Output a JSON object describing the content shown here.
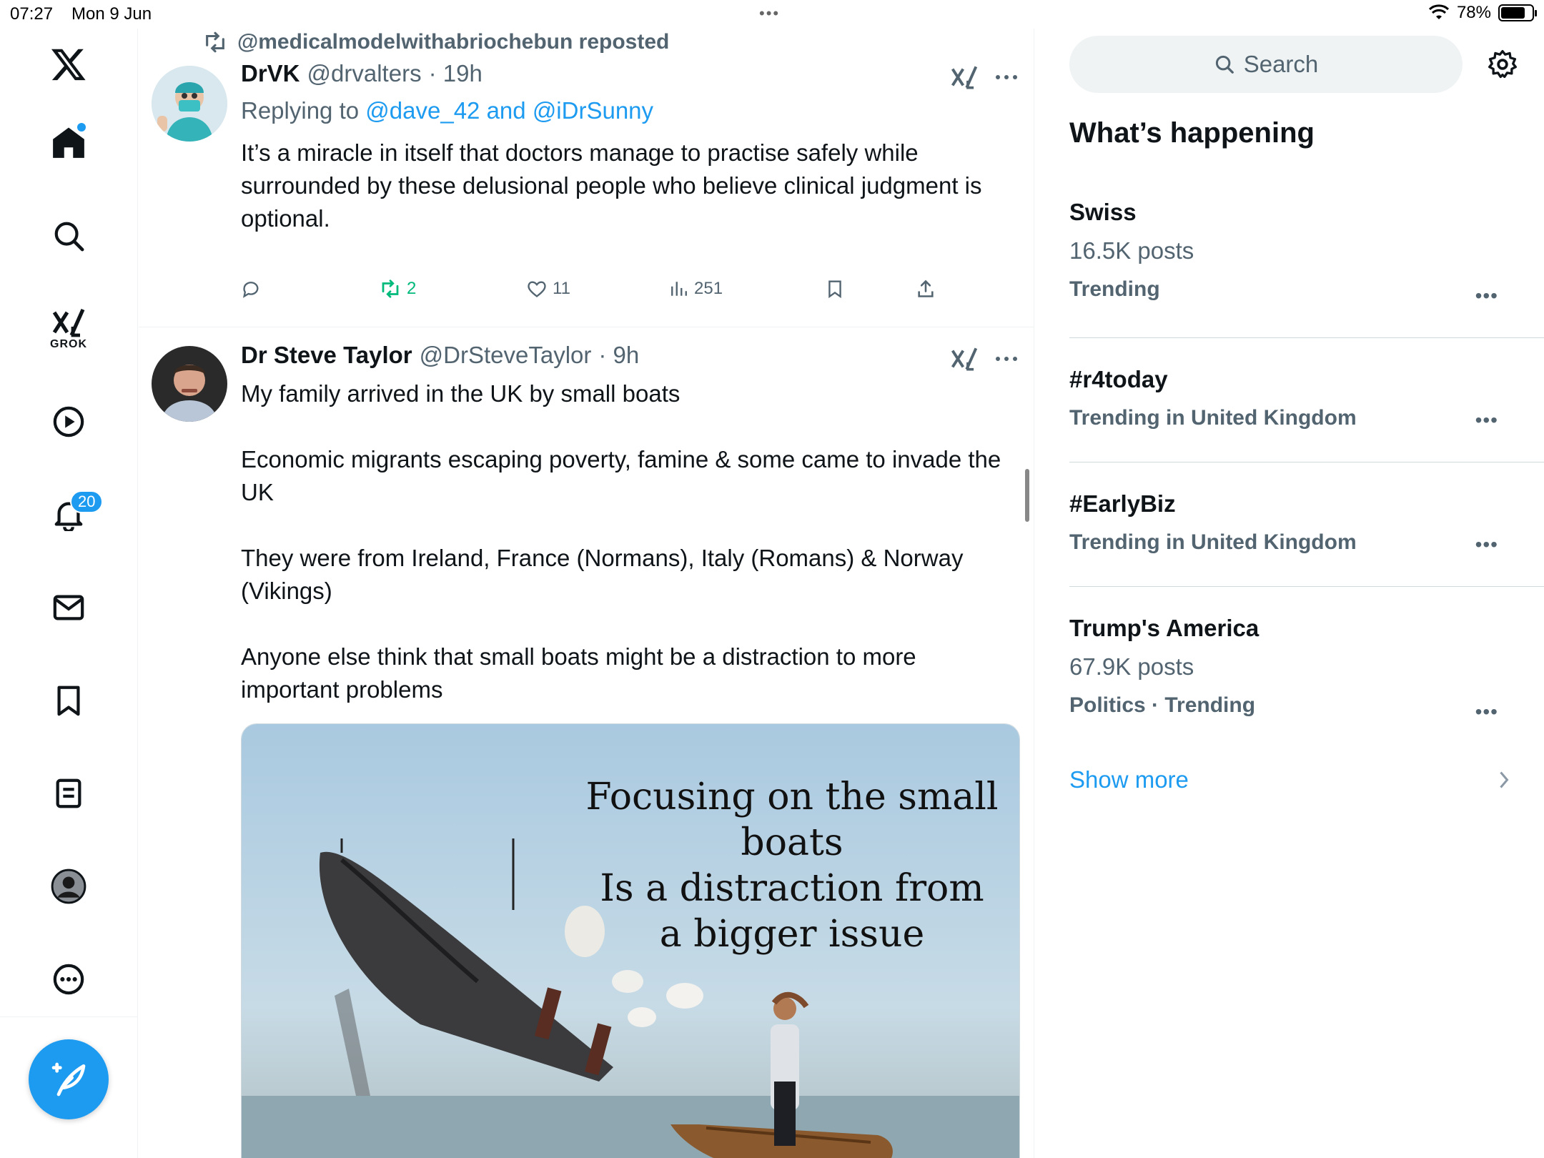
{
  "status_bar": {
    "time": "07:27",
    "date": "Mon 9 Jun",
    "battery": "78%",
    "battery_level": 0.78
  },
  "nav": {
    "notifications_badge": "20",
    "grok_label": "GROK"
  },
  "feed": {
    "repost_label": "@medicalmodelwithabriochebun reposted",
    "tweet1": {
      "name": "DrVK",
      "handle": "@drvalters",
      "time": "· 19h",
      "replying_prefix": "Replying to",
      "replying_to_1": "@dave_42",
      "replying_and": "and",
      "replying_to_2": "@iDrSunny",
      "text": "It’s a miracle in itself that doctors manage to practise safely while surrounded by these delusional people who believe clinical judgment is optional.",
      "retweets": "2",
      "likes": "11",
      "views": "251"
    },
    "tweet2": {
      "name": "Dr Steve Taylor",
      "handle": "@DrSteveTaylor",
      "time": "· 9h",
      "text": "My family arrived in the UK by small boats\n\nEconomic migrants escaping poverty, famine & some came to invade the UK\n\nThey were from Ireland, France (Normans), Italy (Romans) & Norway (Vikings)\n\nAnyone else think that small boats might be a distraction to more important problems",
      "media_caption_1": "Focusing on the small boats",
      "media_caption_2": "Is a distraction from a bigger issue"
    }
  },
  "sidebar": {
    "search_placeholder": "Search",
    "section_title": "What’s happening",
    "trends": [
      {
        "title": "Swiss",
        "meta": "16.5K posts",
        "context": "Trending"
      },
      {
        "title": "#r4today",
        "meta": "",
        "context": "Trending in United Kingdom"
      },
      {
        "title": "#EarlyBiz",
        "meta": "",
        "context": "Trending in United Kingdom"
      },
      {
        "title": "Trump's America",
        "meta": "67.9K posts",
        "context": "Politics · Trending"
      }
    ],
    "show_more": "Show more"
  }
}
